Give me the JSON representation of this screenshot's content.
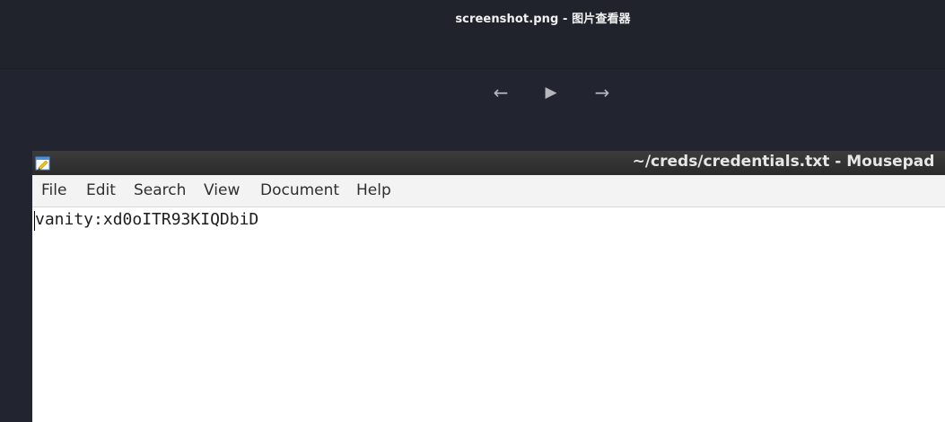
{
  "viewer": {
    "title": "screenshot.png - 图片查看器",
    "toolbar": {
      "prev_icon": "←",
      "play_icon": "▶",
      "next_icon": "→"
    }
  },
  "mousepad": {
    "title": "~/creds/credentials.txt - Mousepad",
    "menu": [
      "File",
      "Edit",
      "Search",
      "View",
      "Document",
      "Help"
    ],
    "content": "vanity:xd0oITR93KIQDbiD"
  }
}
